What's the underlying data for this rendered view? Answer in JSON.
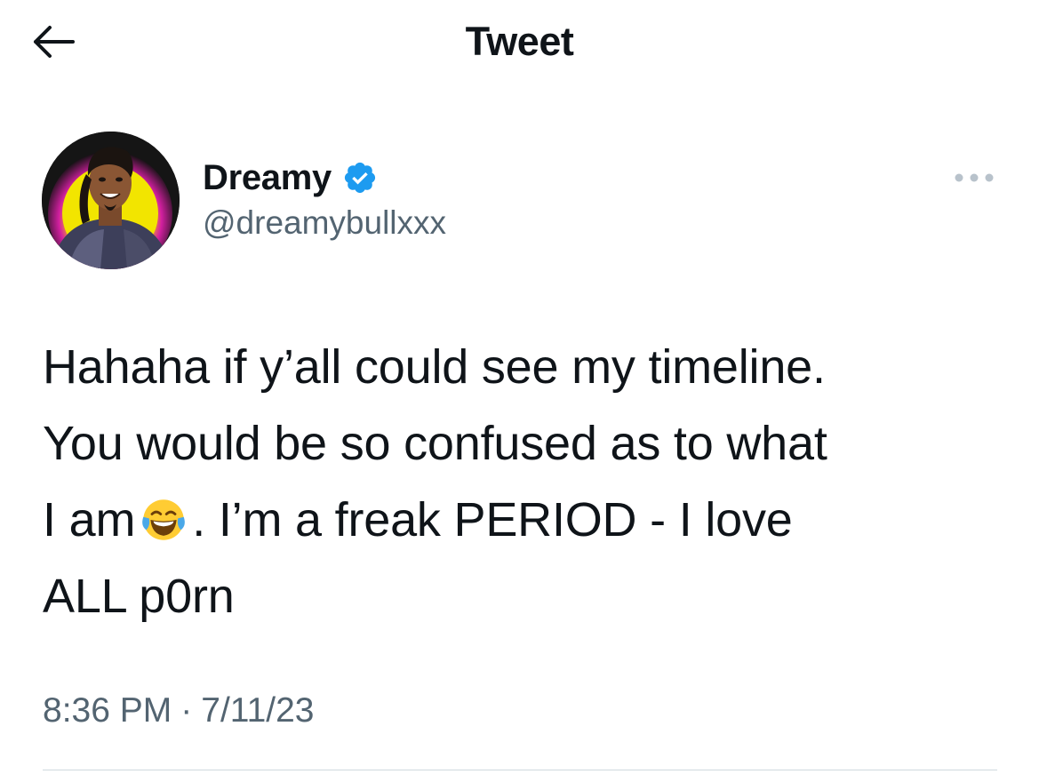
{
  "header": {
    "title": "Tweet",
    "back_icon": "arrow-left-icon"
  },
  "author": {
    "display_name": "Dreamy",
    "handle": "@dreamybullxxx",
    "verified": true,
    "verified_color": "#1d9bf0",
    "avatar_icon": "profile-photo"
  },
  "more_icon": "more-horizontal-icon",
  "tweet": {
    "lines": [
      "Hahaha if y’all could see my timeline.",
      "You would be so confused as to what"
    ],
    "line3_before_emoji": "I am",
    "emoji": "face-with-tears-of-joy",
    "line3_after_emoji": ". I’m a freak PERIOD - I love",
    "line4": "ALL p0rn"
  },
  "meta": {
    "time": "8:36 PM",
    "separator": "·",
    "date": "7/11/23"
  },
  "colors": {
    "text": "#0f1419",
    "secondary_text": "#536471",
    "divider": "#cfd9de"
  }
}
